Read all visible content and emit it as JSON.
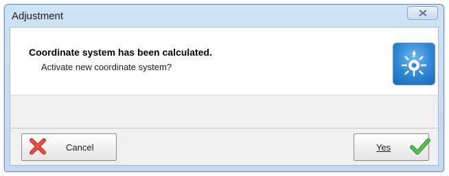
{
  "window": {
    "title": "Adjustment",
    "close_icon": "close-icon"
  },
  "message": {
    "heading": "Coordinate system has been calculated.",
    "subtext": "Activate new coordinate system?",
    "icon": "coordinate-system-icon"
  },
  "buttons": {
    "cancel_label": "Cancel",
    "cancel_icon": "red-x-icon",
    "yes_label": "Yes",
    "yes_icon": "green-checkmark-icon"
  },
  "colors": {
    "cancel_icon": "#d9322b",
    "yes_icon": "#3ea53a",
    "app_icon_bg": "#2f86d4"
  }
}
